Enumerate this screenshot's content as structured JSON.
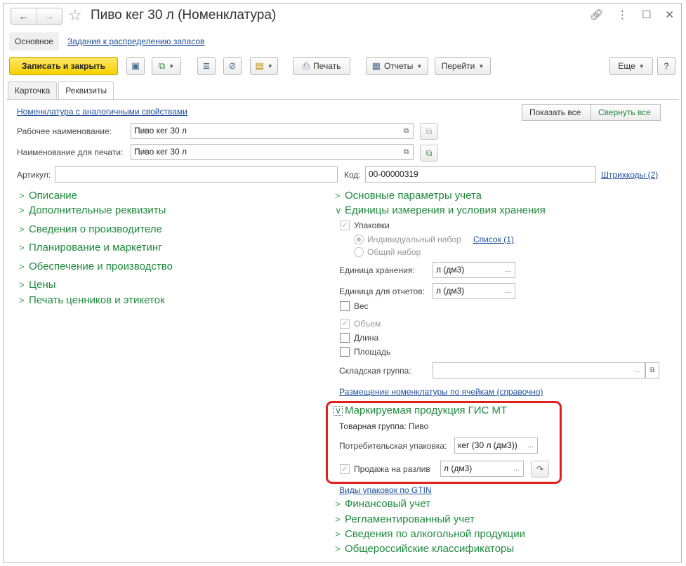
{
  "window": {
    "title": "Пиво кег 30 л (Номенклатура)",
    "nav_back": "←",
    "nav_forward": "→",
    "icons": [
      "link-icon",
      "more-icon",
      "maximize-icon",
      "close-icon"
    ]
  },
  "section_tabs": {
    "main": "Основное",
    "link": "Задания к распределению запасов"
  },
  "toolbar": {
    "save_close": "Записать и закрыть",
    "print": "Печать",
    "reports": "Отчеты",
    "goto": "Перейти",
    "more": "Еще",
    "help": "?"
  },
  "form_tabs": {
    "card": "Карточка",
    "requisites": "Реквизиты"
  },
  "top": {
    "analog_link": "Номенклатура с аналогичными свойствами",
    "show_all": "Показать все",
    "collapse_all": "Свернуть все"
  },
  "fields": {
    "work_name_label": "Рабочее наименование:",
    "work_name_value": "Пиво кег 30 л",
    "print_name_label": "Наименование для печати:",
    "print_name_value": "Пиво кег 30 л",
    "article_label": "Артикул:",
    "article_value": "",
    "code_label": "Код:",
    "code_value": "00-00000319",
    "barcodes_link": "Штрихкоды (2)"
  },
  "left_groups": [
    "Описание",
    "Дополнительные реквизиты",
    "Сведения о производителе",
    "Планирование и маркетинг",
    "Обеспечение и производство",
    "Цены",
    "Печать ценников и этикеток"
  ],
  "right": {
    "group_main_params": "Основные параметры учета",
    "group_units": "Единицы измерения и условия хранения",
    "packages_label": "Упаковки",
    "individual_set": "Индивидуальный набор",
    "list_link": "Список (1)",
    "common_set": "Общий набор",
    "storage_unit_label": "Единица хранения:",
    "storage_unit_value": "л (дм3)",
    "report_unit_label": "Единица для отчетов:",
    "report_unit_value": "л (дм3)",
    "weight": "Вес",
    "volume": "Объем",
    "length": "Длина",
    "area": "Площадь",
    "warehouse_group_label": "Складская группа:",
    "warehouse_group_value": "",
    "placement_link": "Размещение номенклатуры по ячейкам (справочно)",
    "marked_title": "Маркируемая продукция ГИС МТ",
    "product_group": "Товарная группа: Пиво",
    "consumer_pack_label": "Потребительская упаковка:",
    "consumer_pack_value": "кег (30 л (дм3))",
    "draft_sale_label": "Продажа на разлив",
    "draft_sale_value": "л (дм3)",
    "gtin_link": "Виды упаковок по GTIN",
    "group_financial": "Финансовый учет",
    "group_regulated": "Регламентированный учет",
    "group_alcohol": "Сведения по алкогольной продукции",
    "group_classifiers": "Общероссийские классификаторы"
  }
}
